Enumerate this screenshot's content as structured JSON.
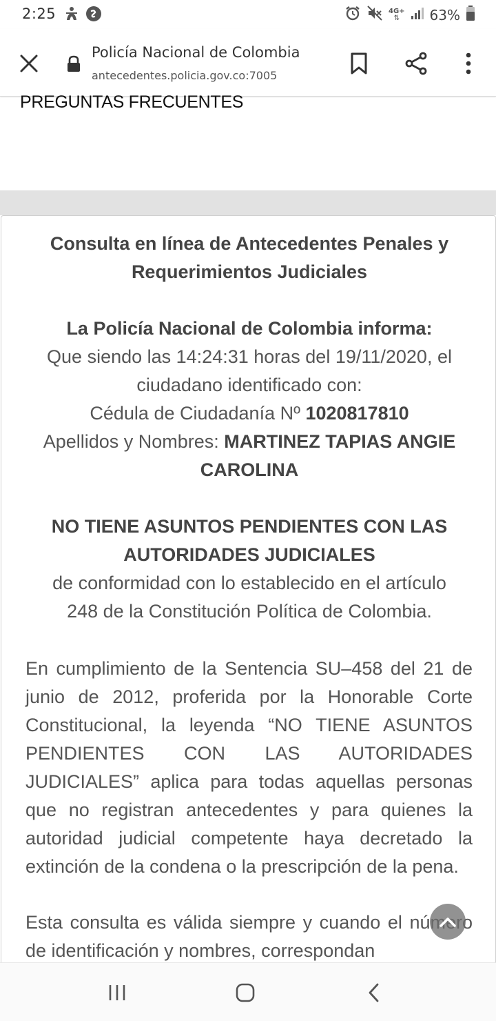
{
  "status_bar": {
    "time": "2:25",
    "battery": "63%",
    "network": "4G+",
    "icons": [
      "accessibility-icon",
      "shazam-icon",
      "alarm-icon",
      "mute-icon",
      "network-4g-icon",
      "signal-icon",
      "battery-icon"
    ]
  },
  "browser": {
    "title": "Policía Nacional de Colombia",
    "url": "antecedentes.policia.gov.co:7005",
    "icons": [
      "close-icon",
      "lock-icon",
      "bookmark-icon",
      "share-icon",
      "more-vert-icon"
    ]
  },
  "page": {
    "faq_link": "PREGUNTAS FRECUENTES",
    "card": {
      "title_line1": "Consulta en línea de Antecedentes Penales y",
      "title_line2": "Requerimientos Judiciales",
      "informs_heading": "La Policía Nacional de Colombia informa:",
      "informs_line1": "Que siendo las 14:24:31 horas del 19/11/2020, el",
      "informs_line2": "ciudadano identificado con:",
      "id_label": "Cédula de Ciudadanía Nº ",
      "id_number": "1020817810",
      "name_label": "Apellidos y Nombres: ",
      "name_value_part1": "MARTINEZ TAPIAS ANGIE",
      "name_value_part2": "CAROLINA",
      "status_line1": "NO TIENE ASUNTOS PENDIENTES CON LAS",
      "status_line2": "AUTORIDADES JUDICIALES",
      "status_ref_line1": "de conformidad con lo establecido en el artículo",
      "status_ref_line2": "248 de la Constitución Política de Colombia.",
      "para1": "En cumplimiento de la Sentencia SU–458 del 21 de junio de 2012, proferida por la Honorable Corte Constitucional, la leyenda “NO TIENE ASUNTOS PENDIENTES CON LAS AUTORIDADES JUDICIALES” aplica para todas aquellas personas que no registran antecedentes y para quienes la autoridad judicial competente haya decretado la extinción de la condena o la prescripción de la pena.",
      "para2": "Esta consulta es válida siempre y cuando el número de identificación y nombres, correspondan"
    }
  },
  "scroll_top_icon": "chevron-up-icon",
  "nav_bar": {
    "icons": [
      "recents-icon",
      "home-icon",
      "back-icon"
    ]
  }
}
